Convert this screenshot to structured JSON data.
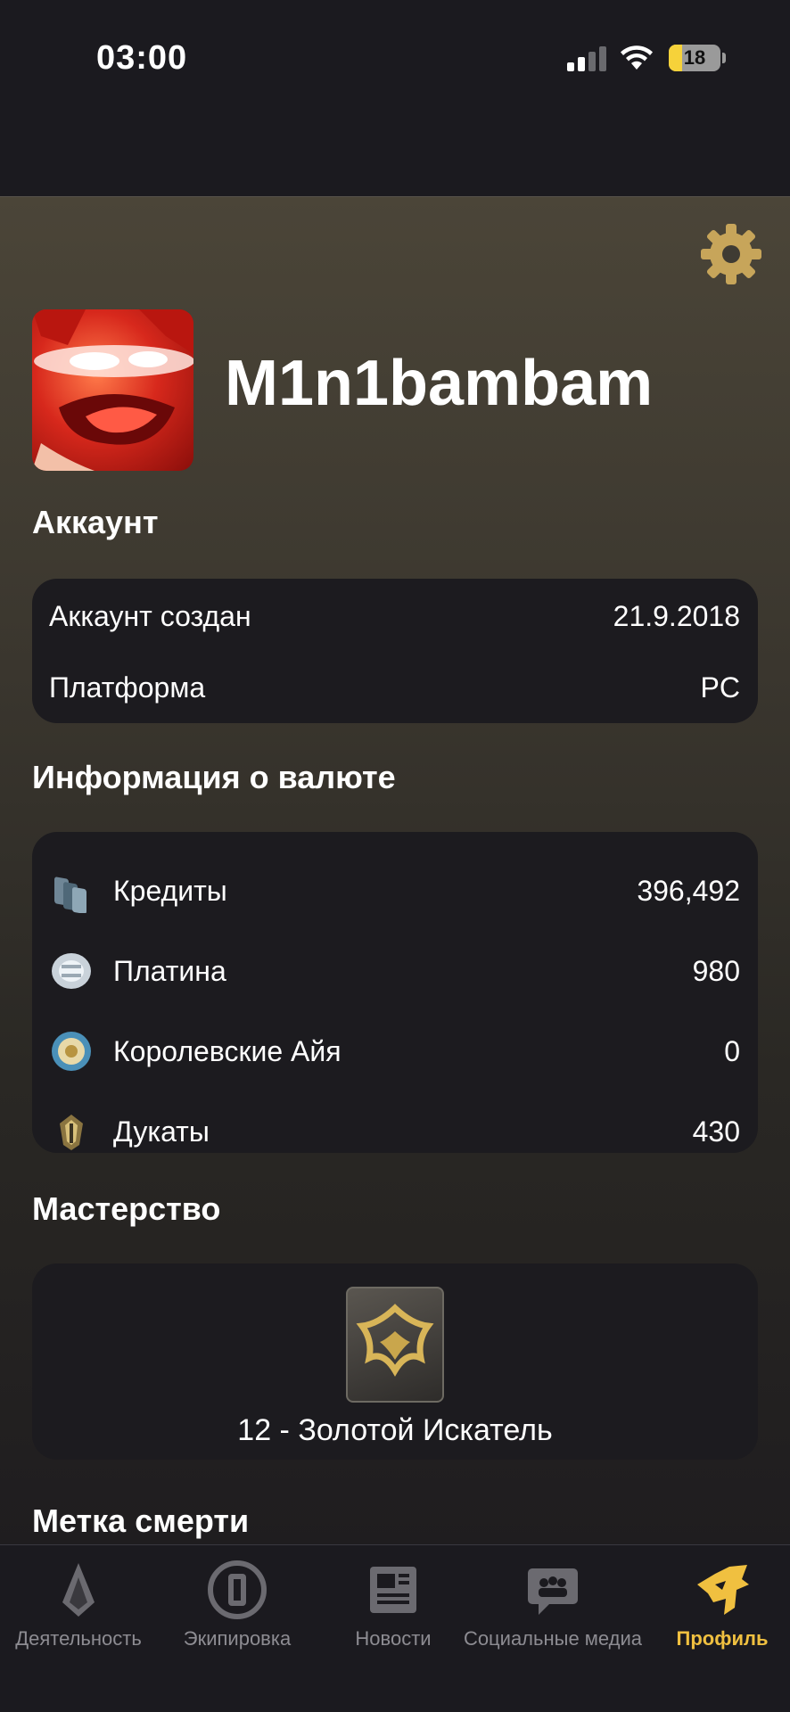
{
  "status_bar": {
    "time": "03:00",
    "battery": "18"
  },
  "profile": {
    "username": "M1n1bambam"
  },
  "account": {
    "title": "Аккаунт",
    "rows": [
      {
        "label": "Аккаунт создан",
        "value": "21.9.2018"
      },
      {
        "label": "Платформа",
        "value": "PC"
      }
    ]
  },
  "currency": {
    "title": "Информация о валюте",
    "rows": [
      {
        "label": "Кредиты",
        "value": "396,492",
        "icon": "credits-icon"
      },
      {
        "label": "Платина",
        "value": "980",
        "icon": "platinum-icon"
      },
      {
        "label": "Королевские Айя",
        "value": "0",
        "icon": "regal-aya-icon"
      },
      {
        "label": "Дукаты",
        "value": "430",
        "icon": "ducats-icon"
      }
    ]
  },
  "mastery": {
    "title": "Мастерство",
    "rank": "12 - Золотой Искатель"
  },
  "death_mark": {
    "title": "Метка смерти"
  },
  "tabs": [
    {
      "label": "Деятельность",
      "icon": "activity-icon"
    },
    {
      "label": "Экипировка",
      "icon": "arsenal-icon"
    },
    {
      "label": "Новости",
      "icon": "news-icon"
    },
    {
      "label": "Социальные медиа",
      "icon": "social-icon"
    },
    {
      "label": "Профиль",
      "icon": "profile-icon",
      "active": true
    }
  ],
  "colors": {
    "accent": "#f0c040",
    "card": "#1c1b1f",
    "background": "#1b1a1f"
  }
}
